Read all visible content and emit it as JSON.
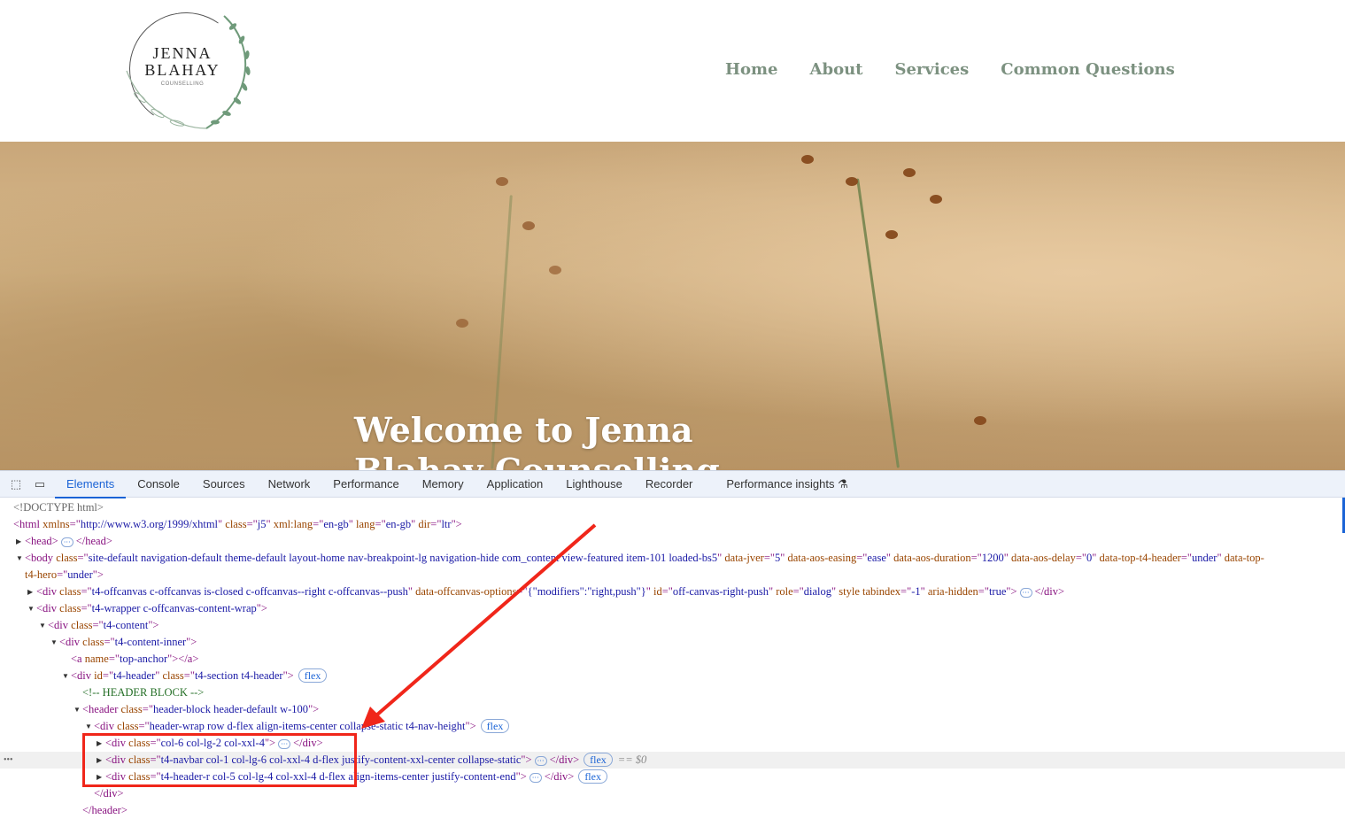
{
  "site": {
    "logo": {
      "line1": "JENNA",
      "line2": "BLAHAY",
      "line3": "COUNSELLING"
    },
    "nav": [
      {
        "label": "Home"
      },
      {
        "label": "About"
      },
      {
        "label": "Services"
      },
      {
        "label": "Common Questions"
      }
    ],
    "hero_title": "Welcome to Jenna Blahay Counselling"
  },
  "devtools": {
    "tabs": [
      {
        "label": "Elements",
        "active": true
      },
      {
        "label": "Console"
      },
      {
        "label": "Sources"
      },
      {
        "label": "Network"
      },
      {
        "label": "Performance"
      },
      {
        "label": "Memory"
      },
      {
        "label": "Application"
      },
      {
        "label": "Lighthouse"
      },
      {
        "label": "Recorder"
      },
      {
        "label": "Performance insights ⚗"
      }
    ],
    "selected_marker": "== $0",
    "row_dots": "•••",
    "colors": {
      "accent": "#1a63d6",
      "tag": "#881280",
      "attr": "#994500",
      "value": "#1a1aa6",
      "annotation": "#f0261a"
    },
    "tree": [
      {
        "level": 0,
        "arrow": "",
        "tokens": [
          [
            "tx",
            "<!DOCTYPE html>"
          ]
        ]
      },
      {
        "level": 0,
        "arrow": "",
        "tokens": [
          [
            "tg",
            "<html "
          ],
          [
            "an",
            "xmlns"
          ],
          [
            "tg",
            "=\""
          ],
          [
            "av",
            "http://www.w3.org/1999/xhtml"
          ],
          [
            "tg",
            "\" "
          ],
          [
            "an",
            "class"
          ],
          [
            "tg",
            "=\""
          ],
          [
            "av",
            "j5"
          ],
          [
            "tg",
            "\" "
          ],
          [
            "an",
            "xml:lang"
          ],
          [
            "tg",
            "=\""
          ],
          [
            "av",
            "en-gb"
          ],
          [
            "tg",
            "\" "
          ],
          [
            "an",
            "lang"
          ],
          [
            "tg",
            "=\""
          ],
          [
            "av",
            "en-gb"
          ],
          [
            "tg",
            "\" "
          ],
          [
            "an",
            "dir"
          ],
          [
            "tg",
            "=\""
          ],
          [
            "av",
            "ltr"
          ],
          [
            "tg",
            "\">"
          ]
        ]
      },
      {
        "level": 1,
        "arrow": "▶",
        "tokens": [
          [
            "tg",
            "<head>"
          ],
          [
            "ell",
            "···"
          ],
          [
            "tg",
            "</head>"
          ]
        ]
      },
      {
        "level": 1,
        "arrow": "▼",
        "tokens": [
          [
            "tg",
            "<body "
          ],
          [
            "an",
            "class"
          ],
          [
            "tg",
            "=\""
          ],
          [
            "av",
            "site-default navigation-default theme-default layout-home nav-breakpoint-lg navigation-hide com_content view-featured item-101 loaded-bs5"
          ],
          [
            "tg",
            "\" "
          ],
          [
            "an",
            "data-jver"
          ],
          [
            "tg",
            "=\""
          ],
          [
            "av",
            "5"
          ],
          [
            "tg",
            "\" "
          ],
          [
            "an",
            "data-aos-easing"
          ],
          [
            "tg",
            "=\""
          ],
          [
            "av",
            "ease"
          ],
          [
            "tg",
            "\" "
          ],
          [
            "an",
            "data-aos-duration"
          ],
          [
            "tg",
            "=\""
          ],
          [
            "av",
            "1200"
          ],
          [
            "tg",
            "\" "
          ],
          [
            "an",
            "data-aos-delay"
          ],
          [
            "tg",
            "=\""
          ],
          [
            "av",
            "0"
          ],
          [
            "tg",
            "\" "
          ],
          [
            "an",
            "data-top-t4-header"
          ],
          [
            "tg",
            "=\""
          ],
          [
            "av",
            "under"
          ],
          [
            "tg",
            "\" "
          ],
          [
            "an",
            "data-top-"
          ]
        ]
      },
      {
        "level": 1,
        "arrow": "",
        "tokens": [
          [
            "an",
            "t4-hero"
          ],
          [
            "tg",
            "=\""
          ],
          [
            "av",
            "under"
          ],
          [
            "tg",
            "\">"
          ]
        ]
      },
      {
        "level": 2,
        "arrow": "▶",
        "tokens": [
          [
            "tg",
            "<div "
          ],
          [
            "an",
            "class"
          ],
          [
            "tg",
            "=\""
          ],
          [
            "av",
            "t4-offcanvas c-offcanvas is-closed c-offcanvas--right c-offcanvas--push"
          ],
          [
            "tg",
            "\" "
          ],
          [
            "an",
            "data-offcanvas-options"
          ],
          [
            "tg",
            "=\""
          ],
          [
            "av",
            "{\"modifiers\":\"right,push\"}"
          ],
          [
            "tg",
            "\" "
          ],
          [
            "an",
            "id"
          ],
          [
            "tg",
            "=\""
          ],
          [
            "av",
            "off-canvas-right-push"
          ],
          [
            "tg",
            "\" "
          ],
          [
            "an",
            "role"
          ],
          [
            "tg",
            "=\""
          ],
          [
            "av",
            "dialog"
          ],
          [
            "tg",
            "\" "
          ],
          [
            "an",
            "style tabindex"
          ],
          [
            "tg",
            "=\""
          ],
          [
            "av",
            "-1"
          ],
          [
            "tg",
            "\" "
          ],
          [
            "an",
            "aria-hidden"
          ],
          [
            "tg",
            "=\""
          ],
          [
            "av",
            "true"
          ],
          [
            "tg",
            "\">"
          ],
          [
            "ell",
            "···"
          ],
          [
            "tg",
            "</div>"
          ]
        ]
      },
      {
        "level": 2,
        "arrow": "▼",
        "tokens": [
          [
            "tg",
            "<div "
          ],
          [
            "an",
            "class"
          ],
          [
            "tg",
            "=\""
          ],
          [
            "av",
            "t4-wrapper c-offcanvas-content-wrap"
          ],
          [
            "tg",
            "\">"
          ]
        ]
      },
      {
        "level": 3,
        "arrow": "▼",
        "tokens": [
          [
            "tg",
            "<div "
          ],
          [
            "an",
            "class"
          ],
          [
            "tg",
            "=\""
          ],
          [
            "av",
            "t4-content"
          ],
          [
            "tg",
            "\">"
          ]
        ]
      },
      {
        "level": 4,
        "arrow": "▼",
        "tokens": [
          [
            "tg",
            "<div "
          ],
          [
            "an",
            "class"
          ],
          [
            "tg",
            "=\""
          ],
          [
            "av",
            "t4-content-inner"
          ],
          [
            "tg",
            "\">"
          ]
        ]
      },
      {
        "level": 5,
        "arrow": "",
        "tokens": [
          [
            "tg",
            "<a "
          ],
          [
            "an",
            "name"
          ],
          [
            "tg",
            "=\""
          ],
          [
            "av",
            "top-anchor"
          ],
          [
            "tg",
            "\"></a>"
          ]
        ]
      },
      {
        "level": 5,
        "arrow": "▼",
        "tokens": [
          [
            "tg",
            "<div "
          ],
          [
            "an",
            "id"
          ],
          [
            "tg",
            "=\""
          ],
          [
            "av",
            "t4-header"
          ],
          [
            "tg",
            "\" "
          ],
          [
            "an",
            "class"
          ],
          [
            "tg",
            "=\""
          ],
          [
            "av",
            "t4-section t4-header"
          ],
          [
            "tg",
            "\">"
          ],
          [
            "badge",
            "flex"
          ]
        ]
      },
      {
        "level": 6,
        "arrow": "",
        "tokens": [
          [
            "cm",
            "<!-- HEADER BLOCK -->"
          ]
        ]
      },
      {
        "level": 6,
        "arrow": "▼",
        "tokens": [
          [
            "tg",
            "<header "
          ],
          [
            "an",
            "class"
          ],
          [
            "tg",
            "=\""
          ],
          [
            "av",
            "header-block header-default w-100"
          ],
          [
            "tg",
            "\">"
          ]
        ]
      },
      {
        "level": 7,
        "arrow": "▼",
        "tokens": [
          [
            "tg",
            "<div "
          ],
          [
            "an",
            "class"
          ],
          [
            "tg",
            "=\""
          ],
          [
            "av",
            "header-wrap row d-flex align-items-center collapse-static t4-nav-height"
          ],
          [
            "tg",
            "\">"
          ],
          [
            "badge",
            "flex"
          ]
        ]
      },
      {
        "level": 8,
        "arrow": "▶",
        "tokens": [
          [
            "tg",
            "<div "
          ],
          [
            "an",
            "class"
          ],
          [
            "tg",
            "=\""
          ],
          [
            "av",
            "col-6 col-lg-2 col-xxl-4"
          ],
          [
            "tg",
            "\">"
          ],
          [
            "ell",
            "···"
          ],
          [
            "tg",
            "</div>"
          ]
        ]
      },
      {
        "level": 8,
        "arrow": "▶",
        "selected": true,
        "tokens": [
          [
            "tg",
            "<div "
          ],
          [
            "an",
            "class"
          ],
          [
            "tg",
            "=\""
          ],
          [
            "av",
            "t4-navbar col-1 col-lg-6 col-xxl-4 d-flex justify-content-xxl-center collapse-static"
          ],
          [
            "tg",
            "\">"
          ],
          [
            "ell",
            "···"
          ],
          [
            "tg",
            "</div>"
          ],
          [
            "badge",
            "flex"
          ],
          [
            "eq",
            "== $0"
          ]
        ]
      },
      {
        "level": 8,
        "arrow": "▶",
        "tokens": [
          [
            "tg",
            "<div "
          ],
          [
            "an",
            "class"
          ],
          [
            "tg",
            "=\""
          ],
          [
            "av",
            "t4-header-r col-5 col-lg-4 col-xxl-4 d-flex align-items-center justify-content-end"
          ],
          [
            "tg",
            "\">"
          ],
          [
            "ell",
            "···"
          ],
          [
            "tg",
            "</div>"
          ],
          [
            "badge",
            "flex"
          ]
        ]
      },
      {
        "level": 7,
        "arrow": "",
        "tokens": [
          [
            "tg",
            "</div>"
          ]
        ]
      },
      {
        "level": 6,
        "arrow": "",
        "tokens": [
          [
            "tg",
            "</header>"
          ]
        ]
      }
    ]
  }
}
